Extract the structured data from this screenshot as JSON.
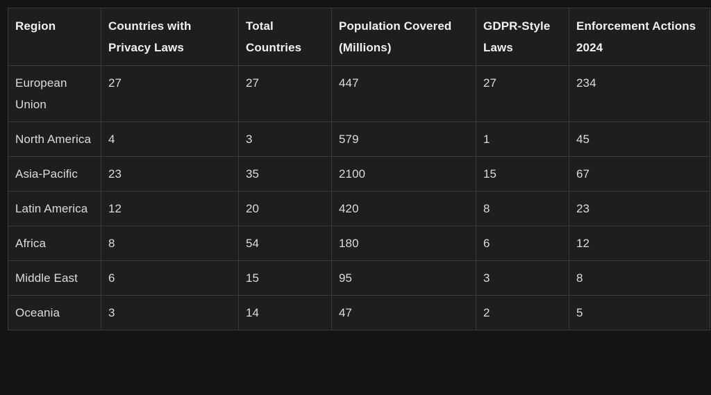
{
  "table": {
    "headers": [
      "Region",
      "Countries with Privacy Laws",
      "Total Countries",
      "Population Covered (Millions)",
      "GDPR-Style Laws",
      "Enforcement Actions 2024"
    ],
    "rows": [
      [
        "European Union",
        "27",
        "27",
        "447",
        "27",
        "234"
      ],
      [
        "North America",
        "4",
        "3",
        "579",
        "1",
        "45"
      ],
      [
        "Asia-Pacific",
        "23",
        "35",
        "2100",
        "15",
        "67"
      ],
      [
        "Latin America",
        "12",
        "20",
        "420",
        "8",
        "23"
      ],
      [
        "Africa",
        "8",
        "54",
        "180",
        "6",
        "12"
      ],
      [
        "Middle East",
        "6",
        "15",
        "95",
        "3",
        "8"
      ],
      [
        "Oceania",
        "3",
        "14",
        "47",
        "2",
        "5"
      ]
    ]
  }
}
